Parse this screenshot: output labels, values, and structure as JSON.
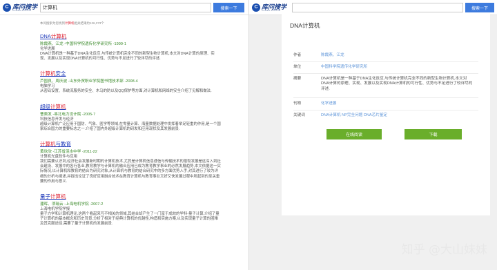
{
  "left": {
    "logo": {
      "mark": "C",
      "text": "库问搜学",
      "sub": "KUWEN SOUXUE"
    },
    "search": {
      "value": "计算机",
      "button": "搜索一下"
    },
    "count": {
      "prefix": "本问搜索为您找到",
      "keyword": "计算机",
      "suffix": "相关结果约126,373个"
    },
    "results": [
      {
        "title": "DNA计算机",
        "meta": "陈霞燕、江龙 -中国科学院遗传化学研究所 -1999-1",
        "source": "化学进展",
        "abstract": "DNA计算机是一种基于DNA生化反应,与传统计算机完全不同的新型生物计算机,本文对DNA计算的原理、实现、发展以及实现DNA计算机的可行性、优势与不足进行了较详尽的评述."
      },
      {
        "title": "计算机安全",
        "meta": "芦国良、周庆波 -山东外贸职业学院图书馆技术部 -2008-4",
        "source": "电脑学习",
        "abstract": "从密码设置、系统流服务的安全、木马的防以及QQ保护等方面,对计算机和网络的安全介绍了见解和做法."
      },
      {
        "title": "超级计算机",
        "meta": "曹東发 -串北电力设计院 -2005-7",
        "source": "科技信息开发与经济",
        "abstract": "超级计算机广泛应用于国防、气象、医学等领域,在零量计算、海量数据处理中发挥着举足轻重的作用,是一个国家综合国力的重要标志之一.介绍了国内外超级计算机的研发和应用现状及其发展前景."
      },
      {
        "title": "计算机与教育",
        "meta": "黄欣欣 -江苏省涟水中学 -2011-22",
        "source": "计算机光盘软件与应用",
        "abstract": "我们需要认识到,经济社会发展新时期的计算机技术,尤其是计算机信息通信与传输技术的蓬勃发展是这深入到社会建设、发展中的各行各业,教育教学与计算机的融合应用已成为教育教学事业的必然发展趋势,本文依据这一实际情况,以计算机和教育的结合为研究对象,从计算机与教育的结合研究中的多方面优势入手,对其进行了较为详细的分析与阐述,并提出论证了良好应用融合技术在教育计算机与教育事业又好又快发展过程中所起到的至关重要的作用与意义."
      },
      {
        "title": "量子计算机",
        "meta": "潘晖、项瑞云 -上海电机学院 -2007-2",
        "source": "上海电机学院学报",
        "abstract": "量子力学和计算机理论,这两个看起来互不相关的领域,其结合却产生了一门富于成效的学科-量子计算,介绍了量子计算机的基本概念和历史背景,分析了相对于经典计算机的优越性,构造和实施方案,以及实现量子计算的困难及其克服途径,需要了量子计算机的发展前景."
      }
    ]
  },
  "right": {
    "logo": {
      "mark": "C",
      "text": "库问搜学",
      "sub": "KUWEN SOUXUE"
    },
    "search": {
      "value": "",
      "button": "搜索一下"
    },
    "detail": {
      "title": "DNA计算机",
      "authors_label": "作者",
      "authors": "陈霞燕、江龙",
      "unit_label": "单位",
      "unit": "中国科学院遗传化学研究所",
      "abstract_label": "摘要",
      "abstract": "DNA计算机是一种基于DNA生化反应,与传统计算机完全不同的新型生物计算机,本文对DNA计算的原理、实现、发展以及实现DNA计算机的可行性、优势与不足进行了较详尽的评述.",
      "journal_label": "刊物",
      "journal": "化学进展",
      "keywords_label": "关键词",
      "keywords": "DNA计算机 NP完全问题 DNA芯片鉴定",
      "read_online": "在线阅读",
      "download": "下载"
    },
    "watermark": {
      "brand": "知乎",
      "handle": "@大山妹妹"
    }
  }
}
